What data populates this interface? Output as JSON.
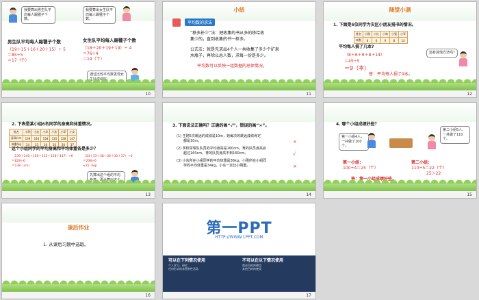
{
  "slides": [
    {
      "num": "10"
    },
    {
      "num": "11",
      "title": "小结",
      "tag": "平均数的求法",
      "l1": "“移多补少”法：把收集的书从多的移给收",
      "l2": "集少的，直到收集的书一样多。",
      "l3": "公式法：就是先求出4个人一共收集了多少个矿泉",
      "l4": "水瓶子，再除以总人数，求每一份是多少。",
      "l5": "平均数可以反映一组数据的总体情况。"
    },
    {
      "num": "12",
      "title": "随堂小测",
      "q": "1. 下面是5位同学为灾区小朋友捐书的情况。",
      "table": [
        [
          "姓名",
          "小刚",
          "小红",
          "小林",
          "小强",
          "小军"
        ],
        [
          "本数",
          "8",
          "6",
          "9",
          "8",
          "14"
        ]
      ],
      "ask": "平均每人捐了几本?",
      "f1": "（8＋6＋9＋8＋14）",
      "f2": "＝45÷5",
      "f3": "＝9（本）",
      "ans": "答：平均每人捐了9本。",
      "b1": "还有其他方法吗?"
    },
    {
      "num": "13",
      "q": "2. 下表是某小组6名同学的身高和体重情况。",
      "table": [
        [
          "姓名",
          "小明",
          "小红",
          "小华",
          "小东",
          "小军",
          "小文"
        ],
        [
          "身高/cm",
          "139",
          "140",
          "158",
          "135",
          "128",
          "147"
        ],
        [
          "体重/kg",
          "34",
          "33",
          "38",
          "36",
          "30",
          "37"
        ]
      ],
      "ask": "这个小组同学的平均身高和平均体重各是多少？",
      "f1": "（139＋140＋158＋135＋128＋147）÷6",
      "f2": "＝828÷6",
      "f3": "＝138（cm）",
      "g1": "（34＋33＋38＋36＋30＋37）÷6",
      "g2": "＝208÷6",
      "g3": "≈35（kg）"
    },
    {
      "num": "14",
      "q": "3. 下面说法正确吗？正确的画“√”，错误的画“×”。",
      "s1": "(1) 王刚5次跳远的成绩是10m，她每次的跳远成绩肯定",
      "s1b": "都是10m。",
      "s2": "(2) 学校举球队队员的平均身高是160cm，育的队员身高会",
      "s2b": "超过160cm，育的队员身高不到160cm。",
      "s3": "(3) 小东所在小组同学的平均体重是36kg，小刚所在小组同",
      "s3b": "学的平均体重是34kg，小东一定比小刚重。",
      "m1": "×",
      "m2": "√",
      "m3": "×"
    },
    {
      "num": "15",
      "q": "4. 哪个小组成绩好些？",
      "b1": "第一小组4人，一共做了100个。",
      "b2": "第二小组5人，一共做了110个。",
      "r1": "第一小组：",
      "r1v": "100÷4＝25（个）",
      "r2": "第二小组：",
      "r2v": "110÷5＝22（个）",
      "cmp": "25＞22",
      "ans": "答：第一小组成绩好些。"
    },
    {
      "num": "16",
      "title": "课后作业",
      "item": "1. 从课后习题中选取。"
    },
    {
      "num": "17",
      "logo": "第一PPT",
      "url": "HTTP://WWW.1PPT.COM",
      "c1h": "可以在下列情况使用",
      "c1a": "个人学习、研究",
      "c1b": "任何形式的非营利性活动",
      "c2h": "不可以在以下情况使用",
      "c2a": "商业目的的使用",
      "c2b": "其他目的的使用"
    }
  ],
  "colors": {
    "accent": "#2c6bb8",
    "red": "#d82a2a",
    "orange": "#e07b2a"
  }
}
